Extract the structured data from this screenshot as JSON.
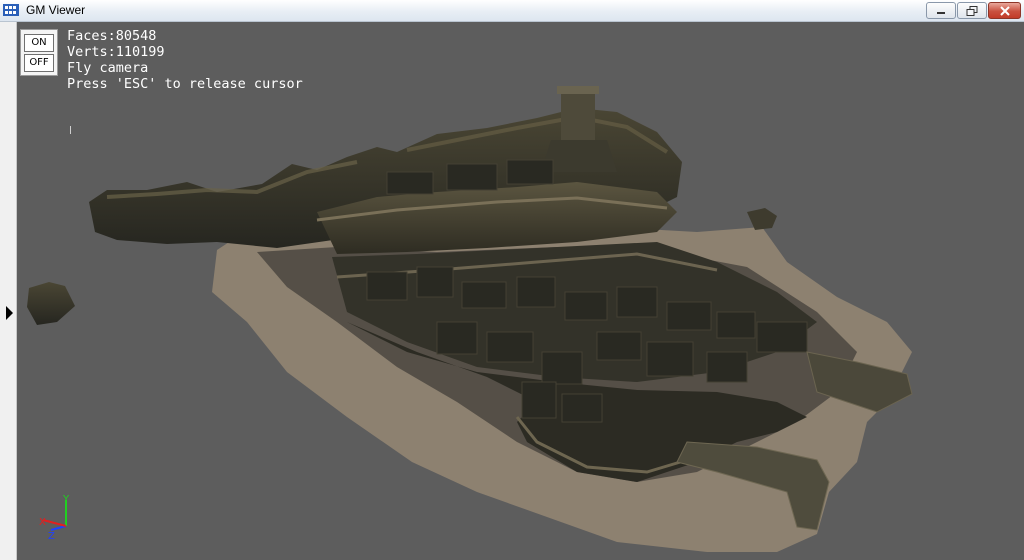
{
  "window": {
    "title": "GM Viewer",
    "icon": "app-icon",
    "controls": [
      "minimize-icon",
      "maximize-icon",
      "close-icon"
    ]
  },
  "toggle": {
    "on_label": "ON",
    "off_label": "OFF"
  },
  "stats": {
    "faces": "Faces:80548",
    "verts": "Verts:110199",
    "camera_mode": "Fly camera",
    "hint": "Press 'ESC' to release cursor"
  },
  "axis_gizmo": {
    "labels": [
      "Y",
      "Z",
      "X"
    ],
    "colors": {
      "x": "#e02020",
      "y": "#20d020",
      "z": "#2040ff"
    }
  },
  "colors": {
    "viewport_bg": "#5d5d5d",
    "sand": "#8d8170",
    "terrain_dark": "#2d2d24"
  }
}
